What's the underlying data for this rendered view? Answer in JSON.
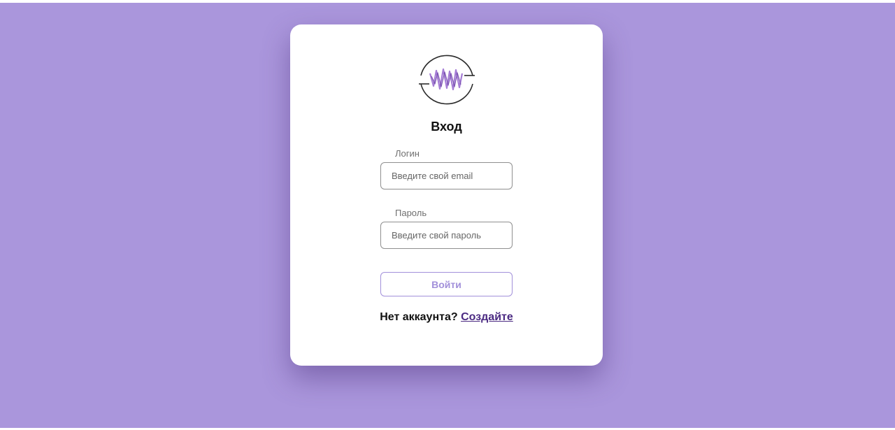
{
  "login": {
    "title": "Вход",
    "email": {
      "label": "Логин",
      "placeholder": "Введите свой email"
    },
    "password": {
      "label": "Пароль",
      "placeholder": "Введите свой пароль"
    },
    "submit_label": "Войти",
    "signup_prompt": "Нет аккаунта?",
    "signup_link": "Создайте"
  },
  "icons": {
    "logo": "wave-logo-icon"
  },
  "colors": {
    "background": "#aa96dc",
    "card": "#ffffff",
    "accent": "#a290da",
    "link": "#4b2a82",
    "logo_wave": "#9b6fd0"
  }
}
